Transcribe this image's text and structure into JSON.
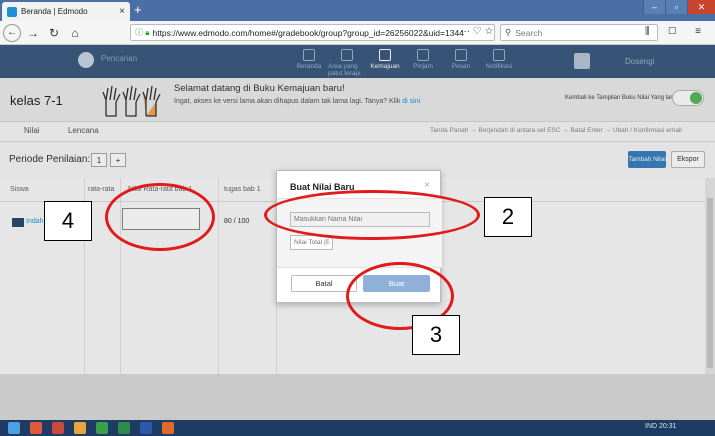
{
  "browser": {
    "tab_title": "Beranda | Edmodo",
    "tab_close": "×",
    "new_tab": "+",
    "window_controls": [
      "–",
      "▫",
      "✕"
    ],
    "url": "https://www.edmodo.com/home#/gradebook/group?group_id=26256022&uid=1344",
    "url_tools": "··· ♡ ☆",
    "search_placeholder": "Search",
    "nav_icons": [
      "back-icon",
      "forward-icon",
      "reload-icon",
      "home-icon"
    ],
    "right_tools": "⫼ ▢ ≡"
  },
  "edmodo": {
    "search_placeholder": "Pencarian",
    "nav": [
      {
        "label": "Beranda",
        "icon": "home-icon"
      },
      {
        "label": "Area yang patut terapi",
        "icon": "backpack-icon"
      },
      {
        "label": "Kemajuan",
        "icon": "progress-icon",
        "active": true
      },
      {
        "label": "Pinjam",
        "icon": "library-icon"
      },
      {
        "label": "Pesan",
        "icon": "message-icon"
      },
      {
        "label": "Notifikasi",
        "icon": "bell-icon"
      }
    ],
    "user_name": "Dosengi"
  },
  "greeting": {
    "class_name": "kelas 7-1",
    "title": "Selamat datang di Buku Kemajuan baru!",
    "subtitle_pre": "Ingat, akses ke versi lama akan dihapus dalam tak lama lagi. Tanya? Klik ",
    "subtitle_link": "di sini",
    "old_view_label": "Kembali ke Tampilan Buku Nilai Yang lama"
  },
  "tabs": {
    "grades": "Nilai",
    "badges": "Lencana",
    "keyboard_hint": "Tanda Panah → Berpindah di antara sel   ESC → Batal   Enter → Ubah / Konfirmasi email"
  },
  "period": {
    "label": "Periode Penilaian:",
    "btn_one": "1",
    "btn_plus": "+",
    "add_grade": "Tambah Nilai",
    "export": "Ekspor"
  },
  "table": {
    "col_student": "Siswa",
    "col_avg": "rata-rata",
    "col_grade_a": "Nilai Rata-rata bab 1",
    "col_task": "tugas bab 1",
    "student_name": "Indah",
    "score": "80 / 100"
  },
  "modal": {
    "title": "Buat Nilai Baru",
    "close": "×",
    "name_placeholder": "Masukkan Nama Nilai",
    "total_placeholder": "Nilai Total (Bernilai)",
    "cancel": "Batal",
    "create": "Buat"
  },
  "annotations": {
    "label_2": "2",
    "label_3": "3",
    "label_4": "4",
    "color": "#e01b1b"
  },
  "taskbar": {
    "tray": "IND  20:31"
  }
}
